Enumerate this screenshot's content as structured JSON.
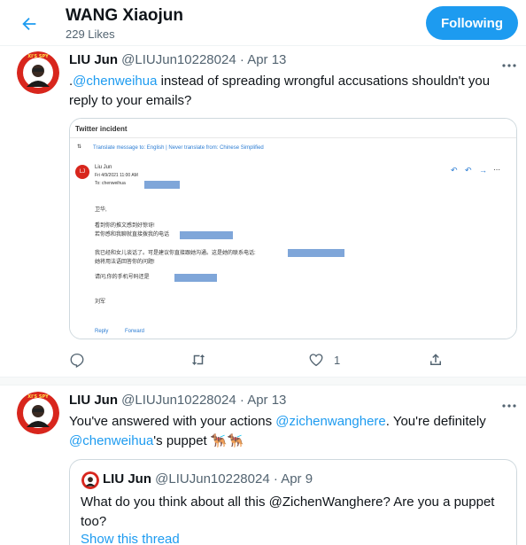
{
  "header": {
    "title": "WANG Xiaojun",
    "subtitle": "229 Likes",
    "follow_label": "Following"
  },
  "tweets": [
    {
      "name": "LIU Jun",
      "handle": "@LIUJun10228024",
      "separator": "·",
      "date": "Apr 13",
      "text_prefix": ".",
      "mention": "@chenweihua",
      "text_rest": " instead of spreading wrongful accusations shouldn't you reply to your emails?",
      "reply_count": "",
      "retweet_count": "",
      "like_count": "1",
      "avatar_badge": "XI'S SPY"
    },
    {
      "name": "LIU Jun",
      "handle": "@LIUJun10228024",
      "separator": "·",
      "date": "Apr 13",
      "text_a": "You've answered with your actions ",
      "mention_a": "@zichenwanghere",
      "text_b": ". You're definitely ",
      "mention_b": "@chenweihua",
      "text_c": "'s puppet ",
      "emoji": "🐕‍🦺🐕‍🦺",
      "avatar_badge": "XI'S SPY",
      "quote": {
        "name": "LIU Jun",
        "handle": "@LIUJun10228024",
        "separator": "·",
        "date": "Apr 9",
        "text": "What do you think about all this @ZichenWanghere? Are you a puppet too?",
        "show_thread": "Show this thread"
      }
    }
  ],
  "email": {
    "subject": "Twitter incident",
    "translate_bar": "Translate message to: English | Never translate from: Chinese Simplified",
    "sender_initials": "LJ",
    "sender": "Liu Jun",
    "date": "Fri 4/9/2021 11:00 AM",
    "to_label": "To: chenweihua",
    "line_greeting": "卫华,",
    "line_1": "看到你的推文感到好惊讶!",
    "line_2": "若你感和我聊就直接拨我的电话",
    "line_3": "我已经和女儿谈话了。可是建议你直接跟她沟通。这是她的联系电话:",
    "line_4": "她将用法语回答你的问题!",
    "line_5": "请问,你的手机号码还是",
    "signature": "刘军",
    "reply_label": "Reply",
    "forward_label": "Forward"
  },
  "colors": {
    "accent": "#1d9bf0",
    "text": "#0f1419",
    "muted": "#536471",
    "avatar_red": "#d8261d"
  }
}
